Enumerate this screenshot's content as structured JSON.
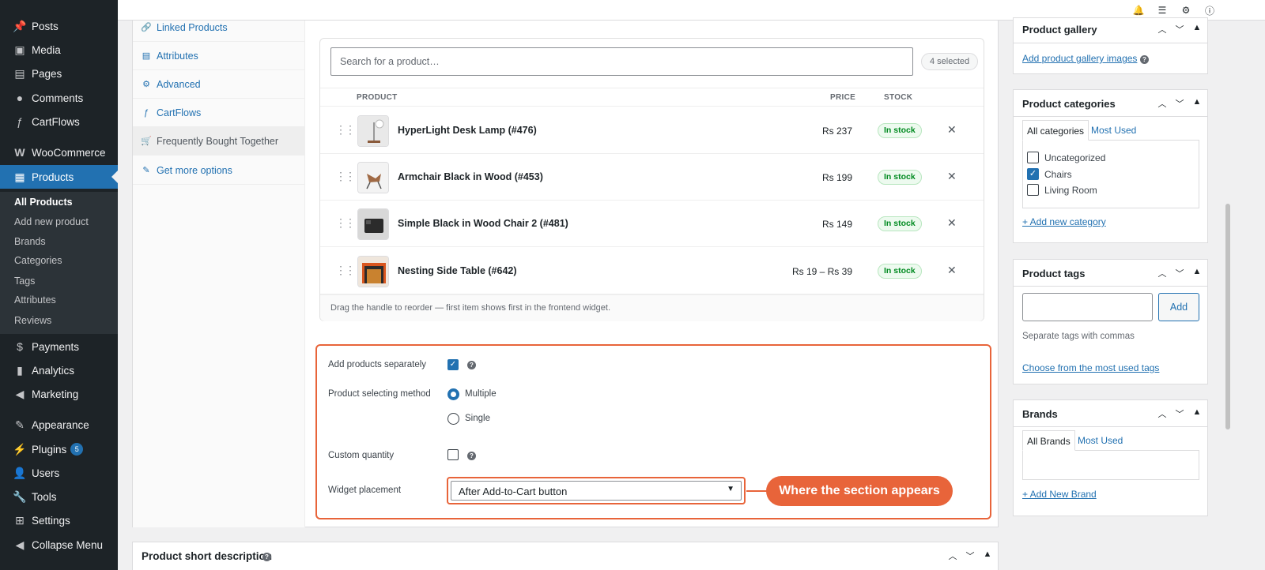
{
  "sidebar": {
    "items": [
      {
        "label": "Posts",
        "icon": "pushpin-icon"
      },
      {
        "label": "Media",
        "icon": "media-icon"
      },
      {
        "label": "Pages",
        "icon": "pages-icon"
      },
      {
        "label": "Comments",
        "icon": "comment-icon"
      },
      {
        "label": "CartFlows",
        "icon": "cartflows-icon"
      },
      {
        "label": "WooCommerce",
        "icon": "woocommerce-icon"
      },
      {
        "label": "Products",
        "icon": "products-icon"
      },
      {
        "label": "Payments",
        "icon": "payments-icon"
      },
      {
        "label": "Analytics",
        "icon": "analytics-icon"
      },
      {
        "label": "Marketing",
        "icon": "megaphone-icon"
      },
      {
        "label": "Appearance",
        "icon": "brush-icon"
      },
      {
        "label": "Plugins",
        "icon": "plug-icon",
        "badge": "5"
      },
      {
        "label": "Users",
        "icon": "user-icon"
      },
      {
        "label": "Tools",
        "icon": "wrench-icon"
      },
      {
        "label": "Settings",
        "icon": "settings-icon"
      },
      {
        "label": "Collapse Menu",
        "icon": "collapse-icon"
      }
    ],
    "products_submenu": [
      "All Products",
      "Add new product",
      "Brands",
      "Categories",
      "Tags",
      "Attributes",
      "Reviews"
    ]
  },
  "topbar": {
    "icons": [
      "bell-icon",
      "list-icon",
      "gear-icon",
      "help-icon"
    ]
  },
  "product_data": {
    "tabs": [
      {
        "label": "Linked Products",
        "icon": "link-icon"
      },
      {
        "label": "Attributes",
        "icon": "table-icon"
      },
      {
        "label": "Advanced",
        "icon": "gear-icon"
      },
      {
        "label": "CartFlows",
        "icon": "cartflows-icon"
      },
      {
        "label": "Frequently Bought Together",
        "icon": "cart-icon"
      },
      {
        "label": "Get more options",
        "icon": "wrench-icon"
      }
    ],
    "search_placeholder": "Search for a product…",
    "selected_count": "4 selected",
    "columns": {
      "product": "PRODUCT",
      "price": "PRICE",
      "stock": "STOCK"
    },
    "products": [
      {
        "name": "HyperLight Desk Lamp (#476)",
        "price": "Rs 237",
        "stock": "In stock"
      },
      {
        "name": "Armchair Black in Wood (#453)",
        "price": "Rs 199",
        "stock": "In stock"
      },
      {
        "name": "Simple Black in Wood Chair 2 (#481)",
        "price": "Rs 149",
        "stock": "In stock"
      },
      {
        "name": "Nesting Side Table (#642)",
        "price": "Rs 19 – Rs 39",
        "stock": "In stock"
      }
    ],
    "footer_hint": "Drag the handle to reorder — first item shows first in the frontend widget.",
    "options": {
      "add_separately_label": "Add products separately",
      "add_separately_checked": true,
      "selecting_method_label": "Product selecting method",
      "method_multiple": "Multiple",
      "method_single": "Single",
      "custom_quantity_label": "Custom quantity",
      "custom_quantity_checked": false,
      "widget_placement_label": "Widget placement",
      "widget_placement_value": "After Add-to-Cart button"
    },
    "callout": "Where the section appears"
  },
  "short_description": {
    "title": "Product short description"
  },
  "right": {
    "gallery": {
      "title": "Product gallery",
      "link": "Add product gallery images"
    },
    "categories": {
      "title": "Product categories",
      "tab_all": "All categories",
      "tab_most": "Most Used",
      "items": [
        {
          "label": "Uncategorized",
          "checked": false
        },
        {
          "label": "Chairs",
          "checked": true
        },
        {
          "label": "Living Room",
          "checked": false
        }
      ],
      "add_link": "+ Add new category"
    },
    "tags": {
      "title": "Product tags",
      "add_button": "Add",
      "hint": "Separate tags with commas",
      "choose_link": "Choose from the most used tags"
    },
    "brands": {
      "title": "Brands",
      "tab_all": "All Brands",
      "tab_most": "Most Used",
      "add_link": "+ Add New Brand"
    }
  },
  "colors": {
    "accent": "#2271b1",
    "highlight": "#e8643a",
    "sidebar": "#1d2327",
    "stock_green": "#008a20"
  }
}
